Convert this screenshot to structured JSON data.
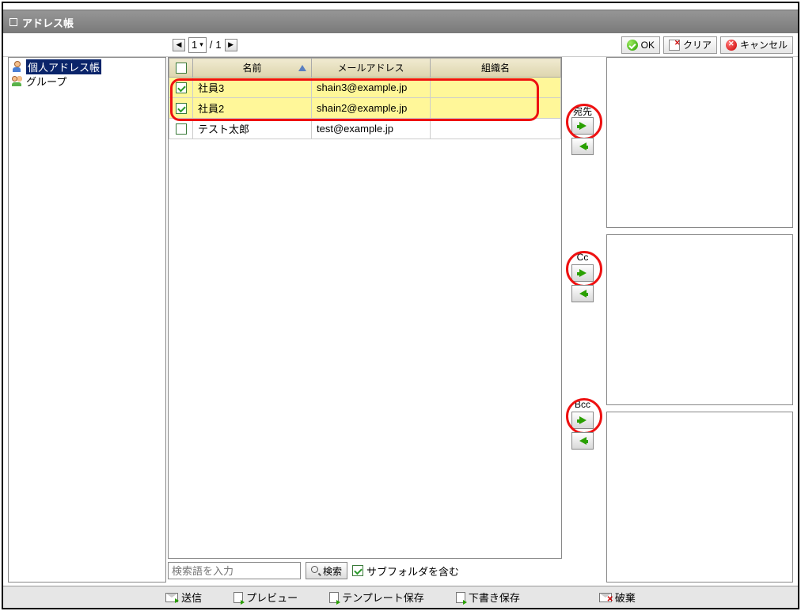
{
  "window": {
    "title": "アドレス帳"
  },
  "pager": {
    "current": "1",
    "separator": "/",
    "total": "1"
  },
  "actions": {
    "ok": "OK",
    "clear": "クリア",
    "cancel": "キャンセル"
  },
  "sidebar": {
    "items": [
      {
        "label": "個人アドレス帳",
        "selected": true
      },
      {
        "label": "グループ",
        "selected": false
      }
    ]
  },
  "table": {
    "headers": {
      "name": "名前",
      "mail": "メールアドレス",
      "org": "組織名"
    },
    "rows": [
      {
        "checked": true,
        "name": "社員3",
        "mail": "shain3@example.jp",
        "org": ""
      },
      {
        "checked": true,
        "name": "社員2",
        "mail": "shain2@example.jp",
        "org": ""
      },
      {
        "checked": false,
        "name": "テスト太郎",
        "mail": "test@example.jp",
        "org": ""
      }
    ]
  },
  "transfer": {
    "to": {
      "label": "宛先"
    },
    "cc": {
      "label": "Cc"
    },
    "bcc": {
      "label": "Bcc"
    }
  },
  "search": {
    "placeholder": "検索語を入力",
    "button": "検索",
    "subfolder_label": "サブフォルダを含む",
    "subfolder_checked": true
  },
  "bottombar": {
    "send": "送信",
    "preview": "プレビュー",
    "template_save": "テンプレート保存",
    "draft_save": "下書き保存",
    "discard": "破棄"
  }
}
